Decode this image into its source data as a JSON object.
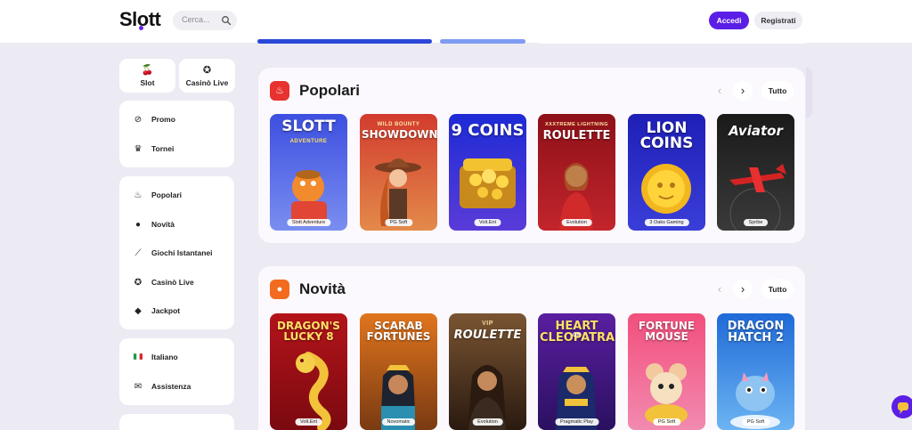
{
  "header": {
    "logo": "Slott",
    "search_placeholder": "Cerca...",
    "login_label": "Accedi",
    "register_label": "Registrati"
  },
  "sidebar": {
    "categories": [
      {
        "label": "Slot",
        "icon": "cherries-icon"
      },
      {
        "label": "Casinò Live",
        "icon": "chip-icon"
      }
    ],
    "group1": [
      {
        "label": "Promo",
        "icon": "percent-icon"
      },
      {
        "label": "Tornei",
        "icon": "trophy-icon"
      }
    ],
    "group2": [
      {
        "label": "Popolari",
        "icon": "fire-icon"
      },
      {
        "label": "Novità",
        "icon": "new-icon"
      },
      {
        "label": "Giochi Istantanei",
        "icon": "chart-icon"
      },
      {
        "label": "Casinò Live",
        "icon": "chip-icon"
      },
      {
        "label": "Jackpot",
        "icon": "diamond-icon"
      }
    ],
    "group3": [
      {
        "label": "Italiano",
        "icon": "italy-flag-icon"
      },
      {
        "label": "Assistenza",
        "icon": "chat-icon"
      }
    ]
  },
  "sections": [
    {
      "title": "Popolari",
      "icon": "fire-icon",
      "accent": "#e8322f",
      "all_label": "Tutto",
      "games": [
        {
          "title": "SLOTT",
          "subtitle": "ADVENTURE",
          "provider": "Slott Adventure"
        },
        {
          "title": "SHOWDOWN",
          "subtitle": "WILD BOUNTY",
          "provider": "PG Soft"
        },
        {
          "title": "9 COINS",
          "subtitle": "",
          "provider": "Volt.Ent"
        },
        {
          "title": "ROULETTE",
          "subtitle": "XXXTREME LIGHTNING",
          "provider": "Evolution"
        },
        {
          "title": "LION COINS",
          "subtitle": "",
          "provider": "3 Oaks Gaming"
        },
        {
          "title": "Aviator",
          "subtitle": "",
          "provider": "Spribe"
        }
      ]
    },
    {
      "title": "Novità",
      "icon": "new-icon",
      "accent": "#f26b1f",
      "all_label": "Tutto",
      "games": [
        {
          "title": "DRAGON'S LUCKY 8",
          "subtitle": "",
          "provider": "Volt.Ent"
        },
        {
          "title": "SCARAB FORTUNES",
          "subtitle": "",
          "provider": "Novomatic"
        },
        {
          "title": "ROULETTE",
          "subtitle": "VIP",
          "provider": "Evolution"
        },
        {
          "title": "HEART CLEOPATRA",
          "subtitle": "OF",
          "provider": "Pragmatic Play"
        },
        {
          "title": "FORTUNE MOUSE",
          "subtitle": "",
          "provider": "PG Soft"
        },
        {
          "title": "DRAGON HATCH 2",
          "subtitle": "",
          "provider": "PG Soft"
        }
      ]
    }
  ]
}
